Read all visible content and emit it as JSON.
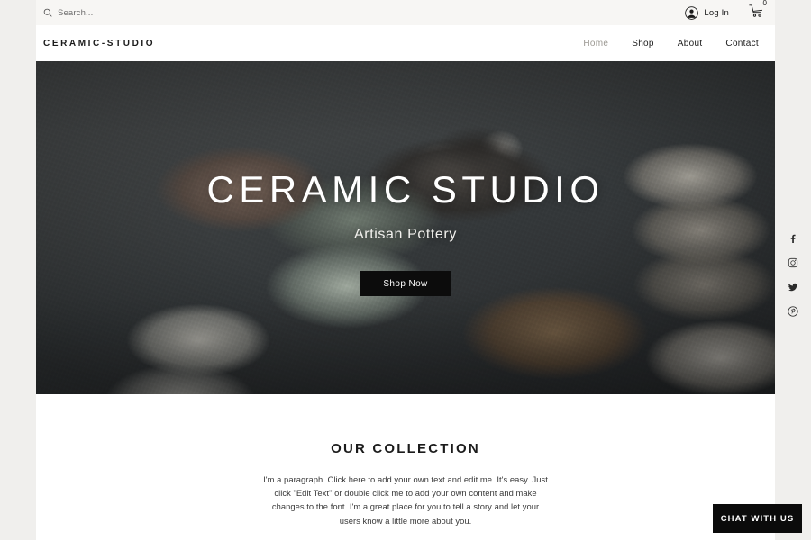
{
  "topbar": {
    "search": {
      "icon": "search-icon",
      "placeholder": "Search...",
      "value": ""
    },
    "login": {
      "icon": "user-avatar-icon",
      "label": "Log In"
    },
    "cart": {
      "icon": "shopping-cart-icon",
      "count": "0"
    }
  },
  "nav": {
    "brand": "CERAMIC-STUDIO",
    "links": [
      {
        "label": "Home",
        "active": true
      },
      {
        "label": "Shop",
        "active": false
      },
      {
        "label": "About",
        "active": false
      },
      {
        "label": "Contact",
        "active": false
      }
    ]
  },
  "hero": {
    "title": "CERAMIC STUDIO",
    "subtitle": "Artisan Pottery",
    "cta_label": "Shop Now",
    "image_alt": "ceramic bowls and plates arranged on a dark slate surface"
  },
  "collection": {
    "title": "OUR COLLECTION",
    "body": "I'm a paragraph. Click here to add your own text and edit me. It's easy. Just click \"Edit Text\" or double click me to add your own content and make changes to the font. I'm a great place for you to tell a story and let your users know a little more about you."
  },
  "social": {
    "items": [
      {
        "icon": "facebook-icon",
        "label": "Facebook"
      },
      {
        "icon": "instagram-icon",
        "label": "Instagram"
      },
      {
        "icon": "twitter-icon",
        "label": "Twitter"
      },
      {
        "icon": "pinterest-icon",
        "label": "Pinterest"
      }
    ]
  },
  "chat": {
    "label": "CHAT WITH US"
  },
  "colors": {
    "page_background": "#f0efed",
    "content_background": "#ffffff",
    "topbar_background": "#f7f6f4",
    "accent_dark": "#0b0b0b",
    "nav_active": "#9b9892",
    "text_primary": "#1b1b1b",
    "hero_overlay_text": "#ffffff"
  }
}
